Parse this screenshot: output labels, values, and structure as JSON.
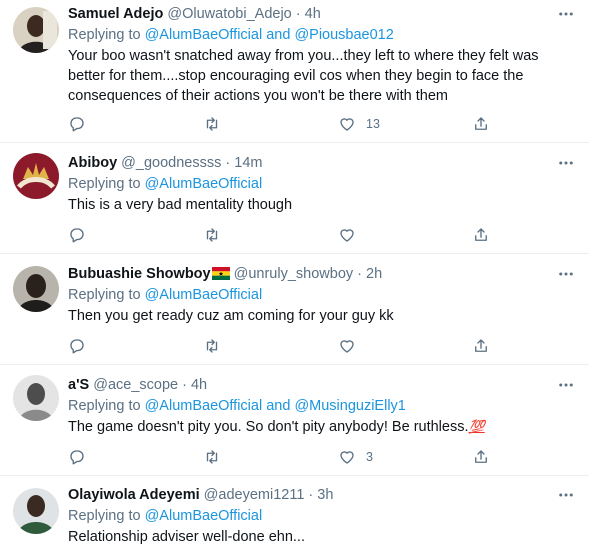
{
  "tweets": [
    {
      "name": "Samuel Adejo",
      "handle": "@Oluwatobi_Adejo",
      "dot": "·",
      "time": "4h",
      "replying_prefix": "Replying to ",
      "mention_1": "@AlumBaeOfficial",
      "and": " and ",
      "mention_2": "@Piousbae012",
      "text": "Your boo wasn't snatched away from you...they left to where they felt was better for them....stop encouraging evil cos when they begin to face the consequences of their actions you won't be there with them",
      "like_count": "13",
      "reply_count": "",
      "retweet_count": ""
    },
    {
      "name": "Abiboy",
      "handle": "@_goodnessss",
      "dot": "·",
      "time": "14m",
      "replying_prefix": "Replying to ",
      "mention_1": "@AlumBaeOfficial",
      "text": "This is a very bad mentality though",
      "like_count": ""
    },
    {
      "name": "Bubuashie Showboy",
      "handle": "@unruly_showboy",
      "dot": "·",
      "time": "2h",
      "flag_icon": "ghana-flag-icon",
      "replying_prefix": "Replying to ",
      "mention_1": "@AlumBaeOfficial",
      "text": "Then you get ready cuz am coming for your guy kk",
      "like_count": ""
    },
    {
      "name": "a'S",
      "handle": "@ace_scope",
      "dot": "·",
      "time": "4h",
      "replying_prefix": "Replying to ",
      "mention_1": "@AlumBaeOfficial",
      "and": " and ",
      "mention_2": "@MusinguziElly1",
      "text": "The game doesn't pity you. So don't pity anybody! Be ruthless.",
      "emoji": "💯",
      "like_count": "3"
    },
    {
      "name": "Olayiwola Adeyemi",
      "handle": "@adeyemi1211",
      "dot": "·",
      "time": "3h",
      "replying_prefix": "Replying to ",
      "mention_1": "@AlumBaeOfficial",
      "text": "Relationship adviser well-done ehn..."
    }
  ],
  "icons": [
    "reply-icon",
    "retweet-icon",
    "like-icon",
    "share-icon",
    "more-icon"
  ],
  "colors": {
    "link": "#1b95e0",
    "secondary": "#5b7083",
    "text": "#0f1419",
    "divider": "#ebeef0"
  }
}
